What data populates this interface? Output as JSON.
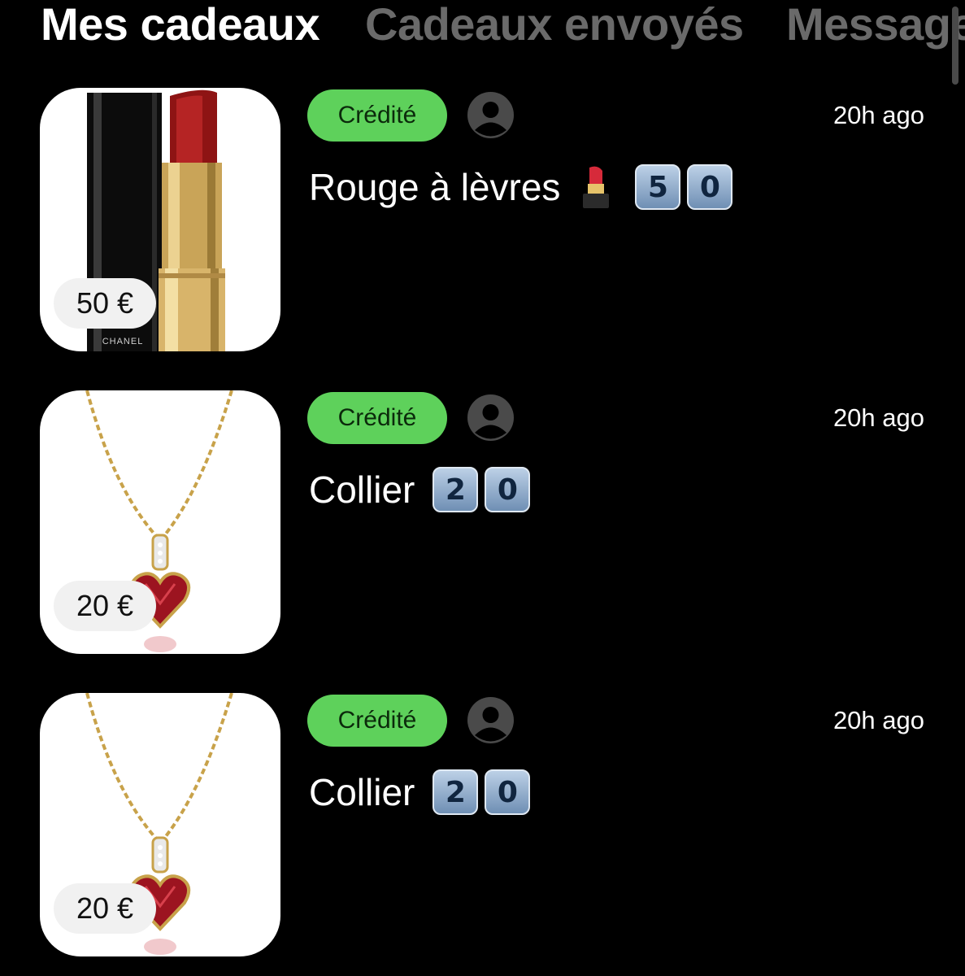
{
  "tabs": [
    {
      "label": "Mes cadeaux",
      "active": true
    },
    {
      "label": "Cadeaux envoyés",
      "active": false
    },
    {
      "label": "Messages",
      "active": false
    }
  ],
  "gifts": [
    {
      "status": "Crédité",
      "time": "20h ago",
      "title": "Rouge à lèvres",
      "emoji": "lipstick-emoji",
      "keycaps": [
        "5",
        "0"
      ],
      "price": "50 €",
      "image": "lipstick",
      "brand_text": "CHANEL"
    },
    {
      "status": "Crédité",
      "time": "20h ago",
      "title": "Collier",
      "keycaps": [
        "2",
        "0"
      ],
      "price": "20 €",
      "image": "heart-necklace"
    },
    {
      "status": "Crédité",
      "time": "20h ago",
      "title": "Collier",
      "keycaps": [
        "2",
        "0"
      ],
      "price": "20 €",
      "image": "heart-necklace"
    }
  ],
  "colors": {
    "background": "#000000",
    "status_green": "#5ed15b",
    "tab_inactive": "#6a6a6a"
  }
}
